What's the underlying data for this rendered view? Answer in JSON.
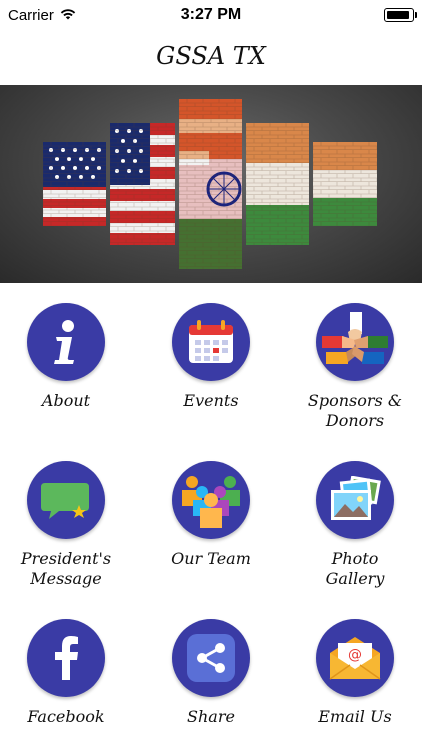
{
  "status_bar": {
    "carrier": "Carrier",
    "time": "3:27 PM"
  },
  "nav": {
    "title": "GSSA TX"
  },
  "banner": {
    "description_icon": "flags-image"
  },
  "menu": [
    {
      "label": "About",
      "icon": "info-icon"
    },
    {
      "label": "Events",
      "icon": "calendar-icon"
    },
    {
      "label": "Sponsors &\nDonors",
      "icon": "hands-icon"
    },
    {
      "label": "President's\nMessage",
      "icon": "message-icon"
    },
    {
      "label": "Our Team",
      "icon": "team-icon"
    },
    {
      "label": "Photo\nGallery",
      "icon": "photos-icon"
    },
    {
      "label": "Facebook",
      "icon": "facebook-icon"
    },
    {
      "label": "Share",
      "icon": "share-icon"
    },
    {
      "label": "Email Us",
      "icon": "email-icon"
    }
  ],
  "colors": {
    "icon_bg": "#3a3ba5",
    "accent_orange": "#f5a623",
    "accent_green": "#4caf50"
  }
}
